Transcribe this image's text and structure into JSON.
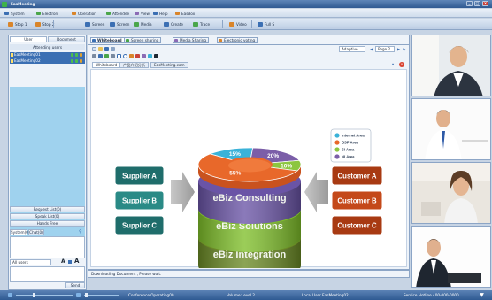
{
  "window": {
    "title": "EasMeeting"
  },
  "menu": [
    {
      "label": "System",
      "icon": "system-icon",
      "color": "#3b6fb3"
    },
    {
      "label": "Electron",
      "icon": "electron-icon",
      "color": "#4aa64a"
    },
    {
      "label": "Operation",
      "icon": "operation-icon",
      "color": "#d9852b"
    },
    {
      "label": "Attendee",
      "icon": "attendee-icon",
      "color": "#4aa64a"
    },
    {
      "label": "View",
      "icon": "view-icon",
      "color": "#8b6bb5"
    },
    {
      "label": "Help",
      "icon": "help-icon",
      "color": "#3b6fb3"
    },
    {
      "label": "EasBox",
      "icon": "easbox-icon",
      "color": "#d9852b"
    }
  ],
  "toolbar": [
    {
      "label": "Stop 1",
      "icon": "stop-icon",
      "color": "#d9852b"
    },
    {
      "label": "Stop 2",
      "icon": "stop-icon",
      "color": "#d9852b"
    },
    {
      "label": "Screen",
      "icon": "screen-icon",
      "color": "#3b6fb3"
    },
    {
      "label": "Screen",
      "icon": "screen-icon",
      "color": "#3b6fb3"
    },
    {
      "label": "Media",
      "icon": "media-icon",
      "color": "#4aa64a"
    },
    {
      "label": "Create",
      "icon": "create-icon",
      "color": "#3b6fb3"
    },
    {
      "label": "Trace",
      "icon": "trace-icon",
      "color": "#4aa64a"
    },
    {
      "label": "Video",
      "icon": "video-icon",
      "color": "#d9852b"
    },
    {
      "label": "Full S",
      "icon": "fullscreen-icon",
      "color": "#3b6fb3"
    }
  ],
  "left": {
    "tabs": [
      "User",
      "Document"
    ],
    "attending_label": "Attending users",
    "attendees": [
      "EasMeeting01",
      "EasMeeting02"
    ],
    "buttons": [
      "Request List(0)",
      "Speak List(0)",
      "Hands Free"
    ],
    "chat_tabs": [
      "System(0)",
      "Chat(0)"
    ],
    "recipient": "All users",
    "font_label": "A",
    "send_label": "Send"
  },
  "main": {
    "tabs": [
      "Whiteboard",
      "Screen sharing",
      "Media Sharing",
      "Electronic voting"
    ],
    "adaptive_label": "Adaptive",
    "page_label": "Page 2",
    "subtabs": [
      "Whiteboard 1",
      "产品介绍分析",
      "EasMeeting.com"
    ],
    "status": "Downloading Document , Please wait."
  },
  "slide": {
    "legend": [
      {
        "label": "Internet Area",
        "color": "#3ab2d8"
      },
      {
        "label": "BSP Area",
        "color": "#e8682a"
      },
      {
        "label": "SI Area",
        "color": "#8cc63f"
      },
      {
        "label": "NI Area",
        "color": "#7b5ea8"
      }
    ],
    "pie": [
      {
        "label": "15%",
        "value": 15,
        "color": "#3ab2d8"
      },
      {
        "label": "20%",
        "value": 20,
        "color": "#7b5ea8"
      },
      {
        "label": "10%",
        "value": 10,
        "color": "#8cc63f"
      },
      {
        "label": "55%",
        "value": 55,
        "color": "#e8682a"
      }
    ],
    "layers": [
      {
        "label": "eBiz Consulting",
        "color": "#6a54a6"
      },
      {
        "label": "eBiz Solutions",
        "color": "#7fbf2a"
      },
      {
        "label": "eBiz Integration",
        "color": "#6b8a25"
      }
    ],
    "suppliers": [
      {
        "label": "Supplier A",
        "color": "#1f6d6b"
      },
      {
        "label": "Supplier B",
        "color": "#2a8a86"
      },
      {
        "label": "Supplier C",
        "color": "#1f6d6b"
      }
    ],
    "customers": [
      {
        "label": "Customer A",
        "color": "#a83a12"
      },
      {
        "label": "Customer B",
        "color": "#c4491a"
      },
      {
        "label": "Customer C",
        "color": "#a83a12"
      }
    ]
  },
  "status": {
    "conference": "Conference Operating00",
    "volume": "Volume:Level 2",
    "local_user": "Local User EasMeeting02",
    "service": "Service Hotline 400-000-0000"
  }
}
